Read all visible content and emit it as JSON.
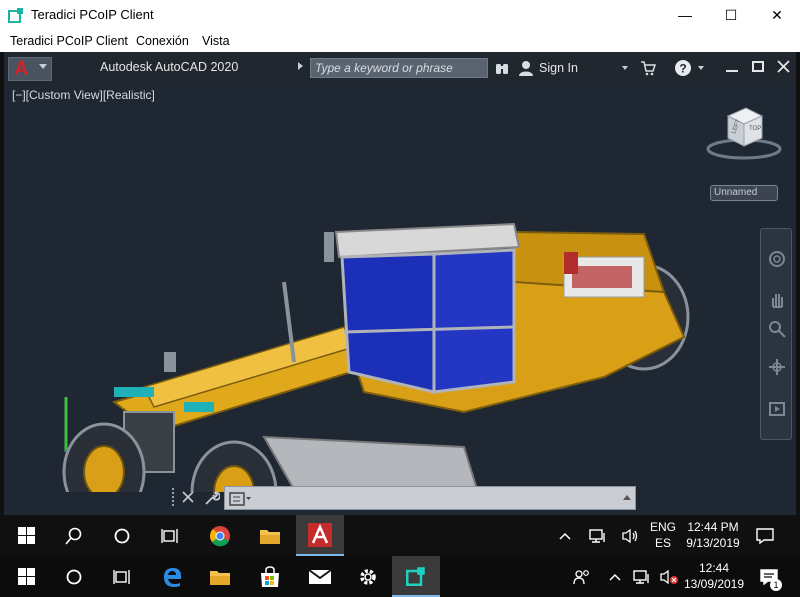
{
  "window": {
    "title": "Teradici PCoIP Client",
    "minimize": "—",
    "maximize": "☐",
    "close": "✕"
  },
  "menu": [
    "Teradici PCoIP Client",
    "Conexión",
    "Vista"
  ],
  "autocad": {
    "logo_letter": "A",
    "title": "Autodesk AutoCAD 2020",
    "search_placeholder": "Type a keyword or phrase",
    "signin": "Sign In",
    "view_label": "[−][Custom View][Realistic]",
    "viewcube_labels": [
      "LEFT",
      "TOP"
    ],
    "ucs_label": "Unnamed",
    "cmd_prompt": ""
  },
  "taskbar_remote": {
    "time": "12:44 PM",
    "date": "9/13/2019",
    "lang1": "ENG",
    "lang2": "ES"
  },
  "taskbar_local": {
    "time": "12:44",
    "date": "13/09/2019",
    "notification_count": "1"
  },
  "colors": {
    "autocad_bg": "#1f2733",
    "machine_yellow": "#d9a017",
    "cab_blue": "#1b2fb8",
    "taskbar_bg": "#0c0c0c"
  }
}
